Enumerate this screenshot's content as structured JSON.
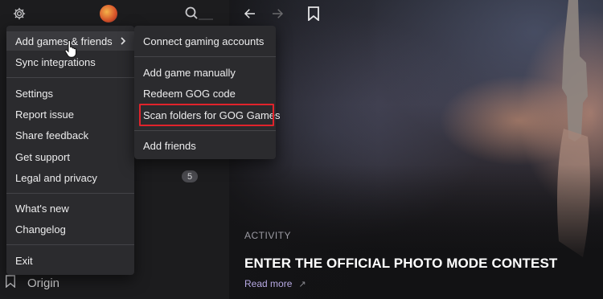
{
  "topbar": {
    "icons": [
      "gear-icon",
      "avatar",
      "search-icon",
      "back-arrow-icon",
      "forward-arrow-icon",
      "bookmark-icon"
    ]
  },
  "main_menu": {
    "items": [
      {
        "label": "Add games & friends",
        "has_submenu": true
      },
      {
        "label": "Sync integrations"
      },
      {
        "label": "Settings"
      },
      {
        "label": "Report issue"
      },
      {
        "label": "Share feedback"
      },
      {
        "label": "Get support"
      },
      {
        "label": "Legal and privacy"
      },
      {
        "label": "What's new"
      },
      {
        "label": "Changelog"
      },
      {
        "label": "Exit"
      }
    ]
  },
  "sub_menu": {
    "items": [
      {
        "label": "Connect gaming accounts"
      },
      {
        "label": "Add game manually"
      },
      {
        "label": "Redeem GOG code"
      },
      {
        "label": "Scan folders for GOG Games",
        "highlighted": true
      },
      {
        "label": "Add friends"
      }
    ]
  },
  "sidebar": {
    "count_badge": "5",
    "origin_label": "Origin"
  },
  "activity": {
    "label": "ACTIVITY",
    "title": "ENTER THE OFFICIAL PHOTO MODE CONTEST",
    "link": "Read more"
  },
  "colors": {
    "menu_bg": "#2b2b2e",
    "highlight_border": "#e0232b",
    "link": "#b7a9e3"
  }
}
